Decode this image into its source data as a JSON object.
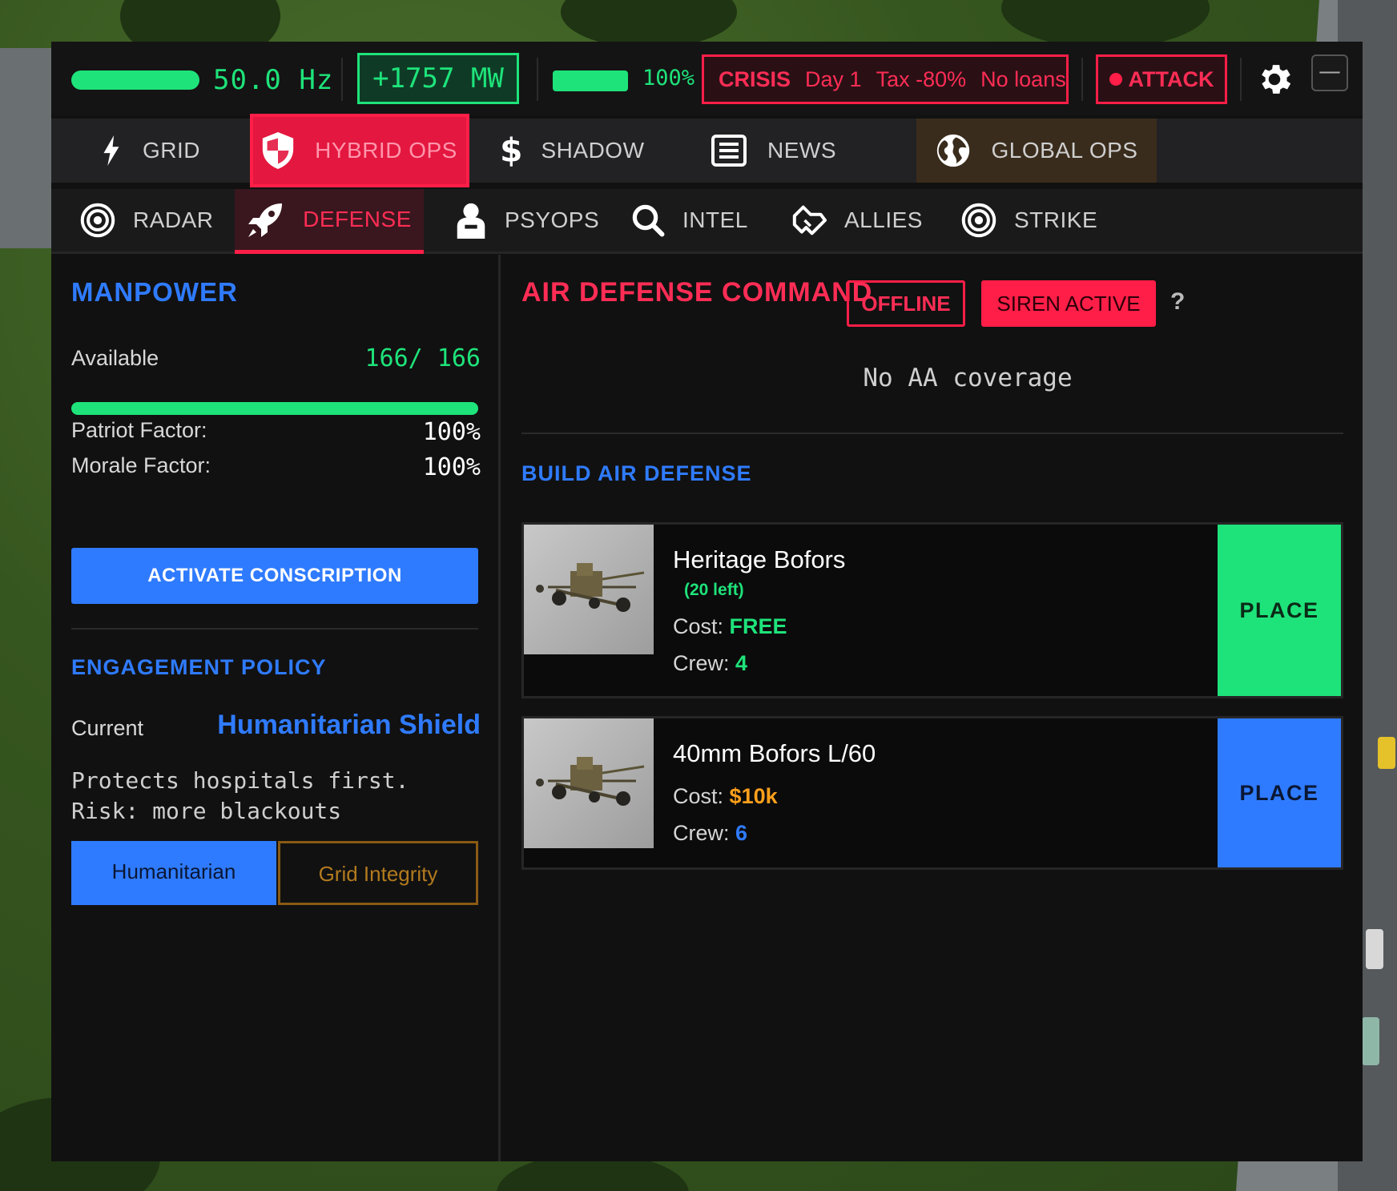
{
  "topbar": {
    "frequency": "50.0 Hz",
    "power_delta": "+1757 MW",
    "battery_pct": "100%",
    "crisis": {
      "label": "CRISIS",
      "day": "Day 1",
      "tax": "Tax -80%",
      "loans": "No loans"
    },
    "attack_label": "ATTACK",
    "minimize_label": "—"
  },
  "main_tabs": [
    {
      "label": "GRID",
      "icon": "lightning-icon",
      "active": false
    },
    {
      "label": "HYBRID OPS",
      "icon": "shield-icon",
      "active": true
    },
    {
      "label": "SHADOW",
      "icon": "dollar-icon",
      "active": false
    },
    {
      "label": "NEWS",
      "icon": "newspaper-icon",
      "active": false
    },
    {
      "label": "GLOBAL OPS",
      "icon": "globe-icon",
      "active": false
    }
  ],
  "sub_tabs": [
    {
      "label": "RADAR",
      "icon": "target-icon",
      "active": false
    },
    {
      "label": "DEFENSE",
      "icon": "rocket-icon",
      "active": true
    },
    {
      "label": "PSYOPS",
      "icon": "brain-icon",
      "active": false
    },
    {
      "label": "INTEL",
      "icon": "search-icon",
      "active": false
    },
    {
      "label": "ALLIES",
      "icon": "handshake-icon",
      "active": false
    },
    {
      "label": "STRIKE",
      "icon": "target-icon",
      "active": false
    }
  ],
  "manpower": {
    "title": "MANPOWER",
    "available_label": "Available",
    "available_value": "166/ 166",
    "available_fraction": 1.0,
    "patriot_label": "Patriot Factor:",
    "patriot_value": "100%",
    "morale_label": "Morale Factor:",
    "morale_value": "100%",
    "conscription_button": "ACTIVATE CONSCRIPTION"
  },
  "engagement": {
    "title": "ENGAGEMENT POLICY",
    "current_label": "Current",
    "current_value": "Humanitarian Shield",
    "description": "Protects hospitals first. Risk: more blackouts",
    "options": [
      "Humanitarian",
      "Grid Integrity"
    ],
    "selected": "Humanitarian"
  },
  "air_defense": {
    "title": "AIR DEFENSE COMMAND",
    "status_offline": "OFFLINE",
    "status_siren": "SIREN ACTIVE",
    "help": "?",
    "coverage": "No AA coverage",
    "build_title": "BUILD AIR DEFENSE",
    "units": [
      {
        "name": "Heritage Bofors",
        "remaining": "(20 left)",
        "cost_label": "Cost:",
        "cost_value": "FREE",
        "crew_label": "Crew:",
        "crew_value": "4",
        "place_label": "PLACE"
      },
      {
        "name": "40mm Bofors L/60",
        "cost_label": "Cost:",
        "cost_value": "$10k",
        "crew_label": "Crew:",
        "crew_value": "6",
        "place_label": "PLACE"
      }
    ]
  },
  "colors": {
    "accent_green": "#1ee37a",
    "accent_red": "#ff1e47",
    "accent_blue": "#2f7bff",
    "accent_orange": "#ff9f1c"
  }
}
